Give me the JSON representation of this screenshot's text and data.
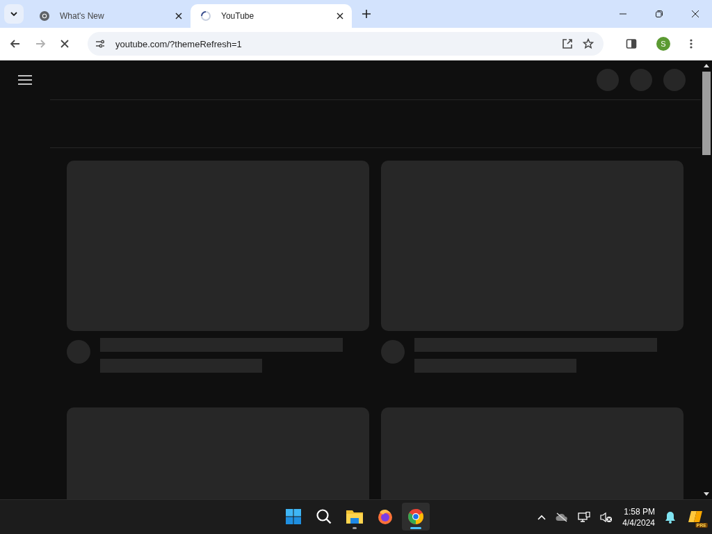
{
  "tabs": [
    {
      "title": "What's New",
      "selected": false,
      "kind": "chrome"
    },
    {
      "title": "YouTube",
      "selected": true,
      "kind": "loading"
    }
  ],
  "address_bar": {
    "url": "youtube.com/?themeRefresh=1"
  },
  "page": {
    "loading": true
  },
  "profile": {
    "initial": "S"
  },
  "taskbar": {
    "apps": [
      {
        "kind": "start",
        "active": false,
        "running": false
      },
      {
        "kind": "search",
        "active": false,
        "running": false
      },
      {
        "kind": "files",
        "active": false,
        "running": true
      },
      {
        "kind": "firefox",
        "active": false,
        "running": false
      },
      {
        "kind": "chrome",
        "active": true,
        "running": true
      }
    ],
    "time": "1:58 PM",
    "date": "4/4/2024",
    "badge": "PRE"
  }
}
